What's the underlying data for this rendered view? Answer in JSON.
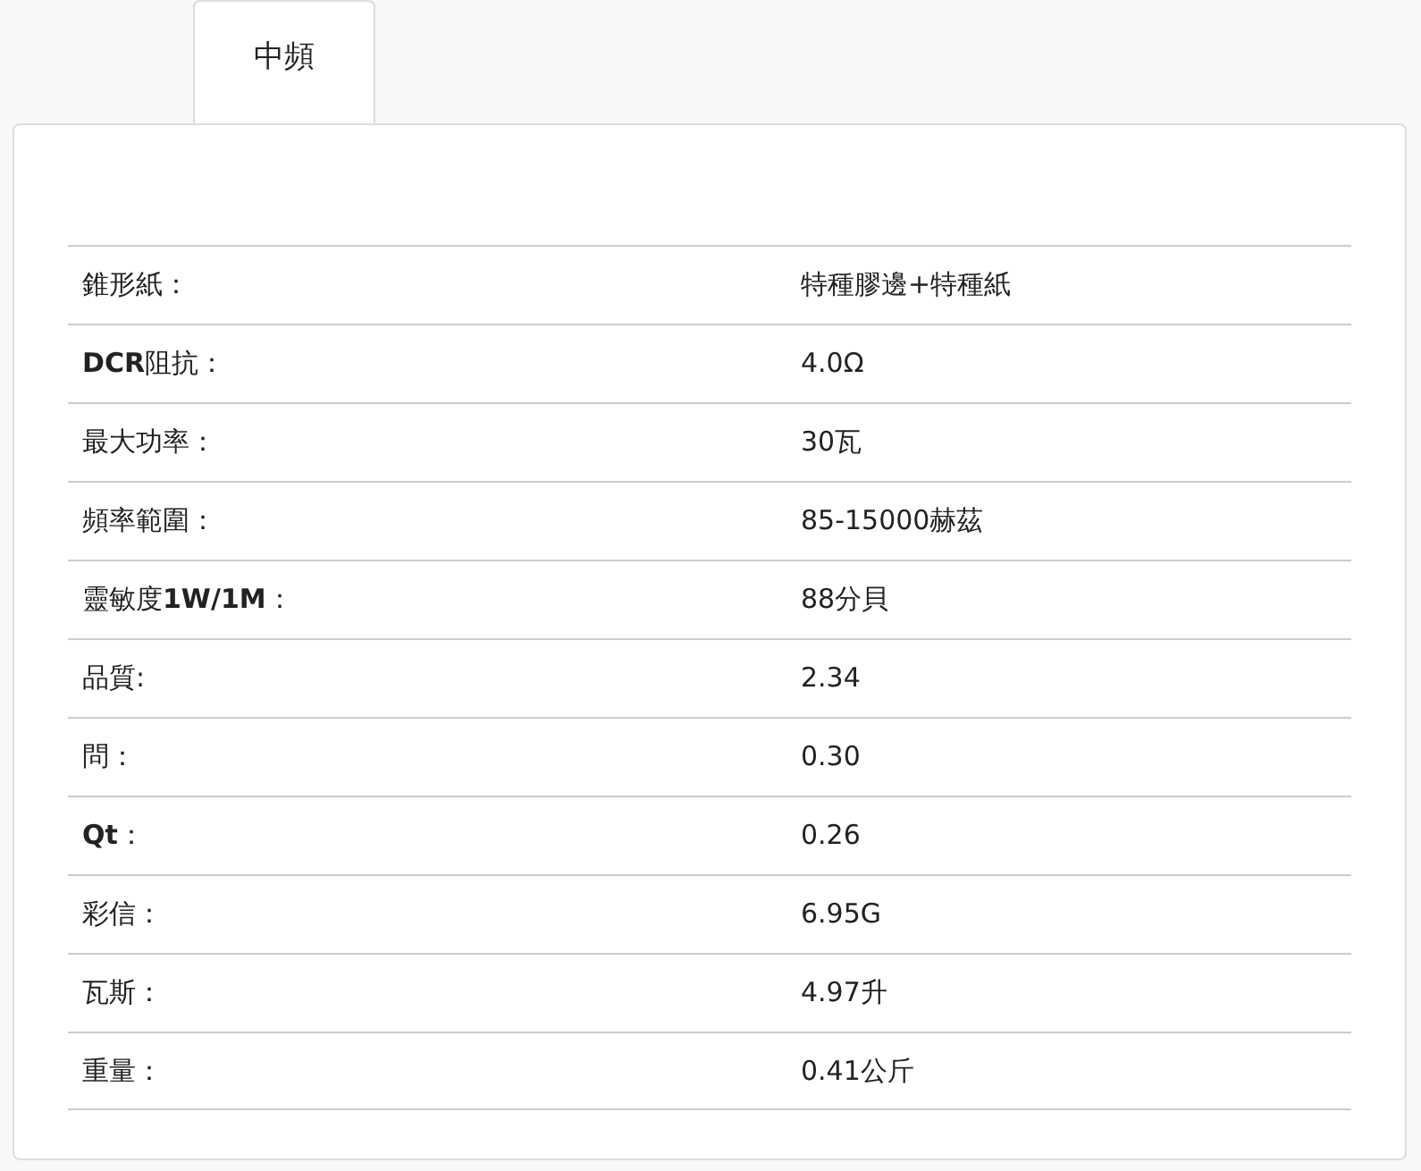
{
  "tabs": [
    {
      "label": "中頻",
      "selected": true
    }
  ],
  "specs": [
    {
      "label": "錐形紙：",
      "value": "特種膠邊+特種紙"
    },
    {
      "label": "**DCR**阻抗：",
      "value": "4.0Ω"
    },
    {
      "label": "最大功率：",
      "value": "30瓦"
    },
    {
      "label": "頻率範圍：",
      "value": "85-15000赫茲"
    },
    {
      "label": "靈敏度**1W/1M**：",
      "value": "88分貝"
    },
    {
      "label": "品質:",
      "value": "2.34"
    },
    {
      "label": "問：",
      "value": "0.30"
    },
    {
      "label": "**Qt**：",
      "value": "0.26"
    },
    {
      "label": "彩信：",
      "value": "6.95G"
    },
    {
      "label": "瓦斯：",
      "value": "4.97升"
    },
    {
      "label": "重量：",
      "value": "0.41公斤"
    }
  ]
}
